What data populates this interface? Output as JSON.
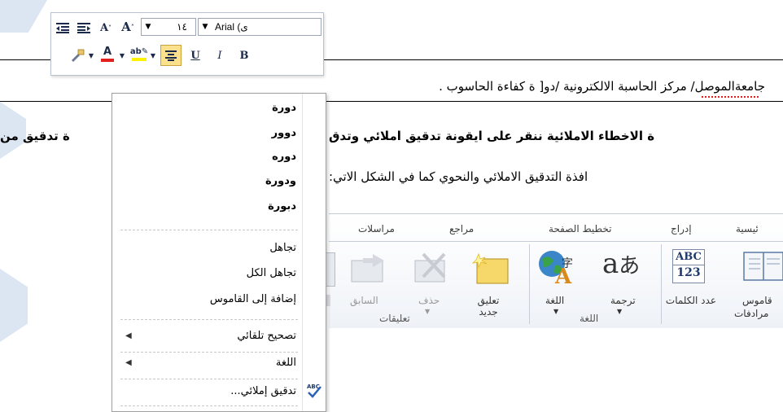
{
  "document": {
    "line1": "جامعةالموصل/ مركز الحاسبة الالكترونية  /دو[ ة كفاءة الحاسوب .",
    "line2_right": "ة الاخطاء الاملائية ننقر على ايقونة تدقيق املائي وتدق",
    "line2_left": "ة تدقيق من",
    "line3": "افذة التدقيق الاملائي والنحوي كما في الشكل الاتي:"
  },
  "mini_toolbar": {
    "font_name": "Arial (ى",
    "font_size": "١٤",
    "bold_label": "B",
    "italic_label": "I",
    "underline_label": "U"
  },
  "context_menu": {
    "suggestions": [
      "دورة",
      "دوور",
      "دوره",
      "ودورة",
      "دبورة"
    ],
    "ignore": "تجاهل",
    "ignore_all": "تجاهل الكل",
    "add_to_dictionary": "إضافة إلى القاموس",
    "autocorrect": "تصحيح تلقائي",
    "language": "اللغة",
    "spelling": "تدقيق إملائي..."
  },
  "ribbon": {
    "tabs": [
      "ئيسية",
      "إدراج",
      "تخطيط الصفحة",
      "مراجع",
      "مراسلات"
    ],
    "buttons": {
      "dictionary": "قاموس",
      "synonyms": "مرادفات",
      "word_count": "عدد الكلمات",
      "translate": "ترجمة",
      "language": "اللغة",
      "new_comment": "تعليق جديد",
      "delete": "حذف",
      "previous": "السابق"
    },
    "groups": {
      "language": "اللغة",
      "comments": "تعليقات"
    },
    "abc_top": "ABC",
    "abc_bottom": "123"
  },
  "colors": {
    "menu_border": "#a0a0a0",
    "ribbon_border": "#c5ccd6",
    "font_color_underline": "#e0201c",
    "highlight_yellow": "#fff200",
    "watermark": "#c9d8ea"
  }
}
